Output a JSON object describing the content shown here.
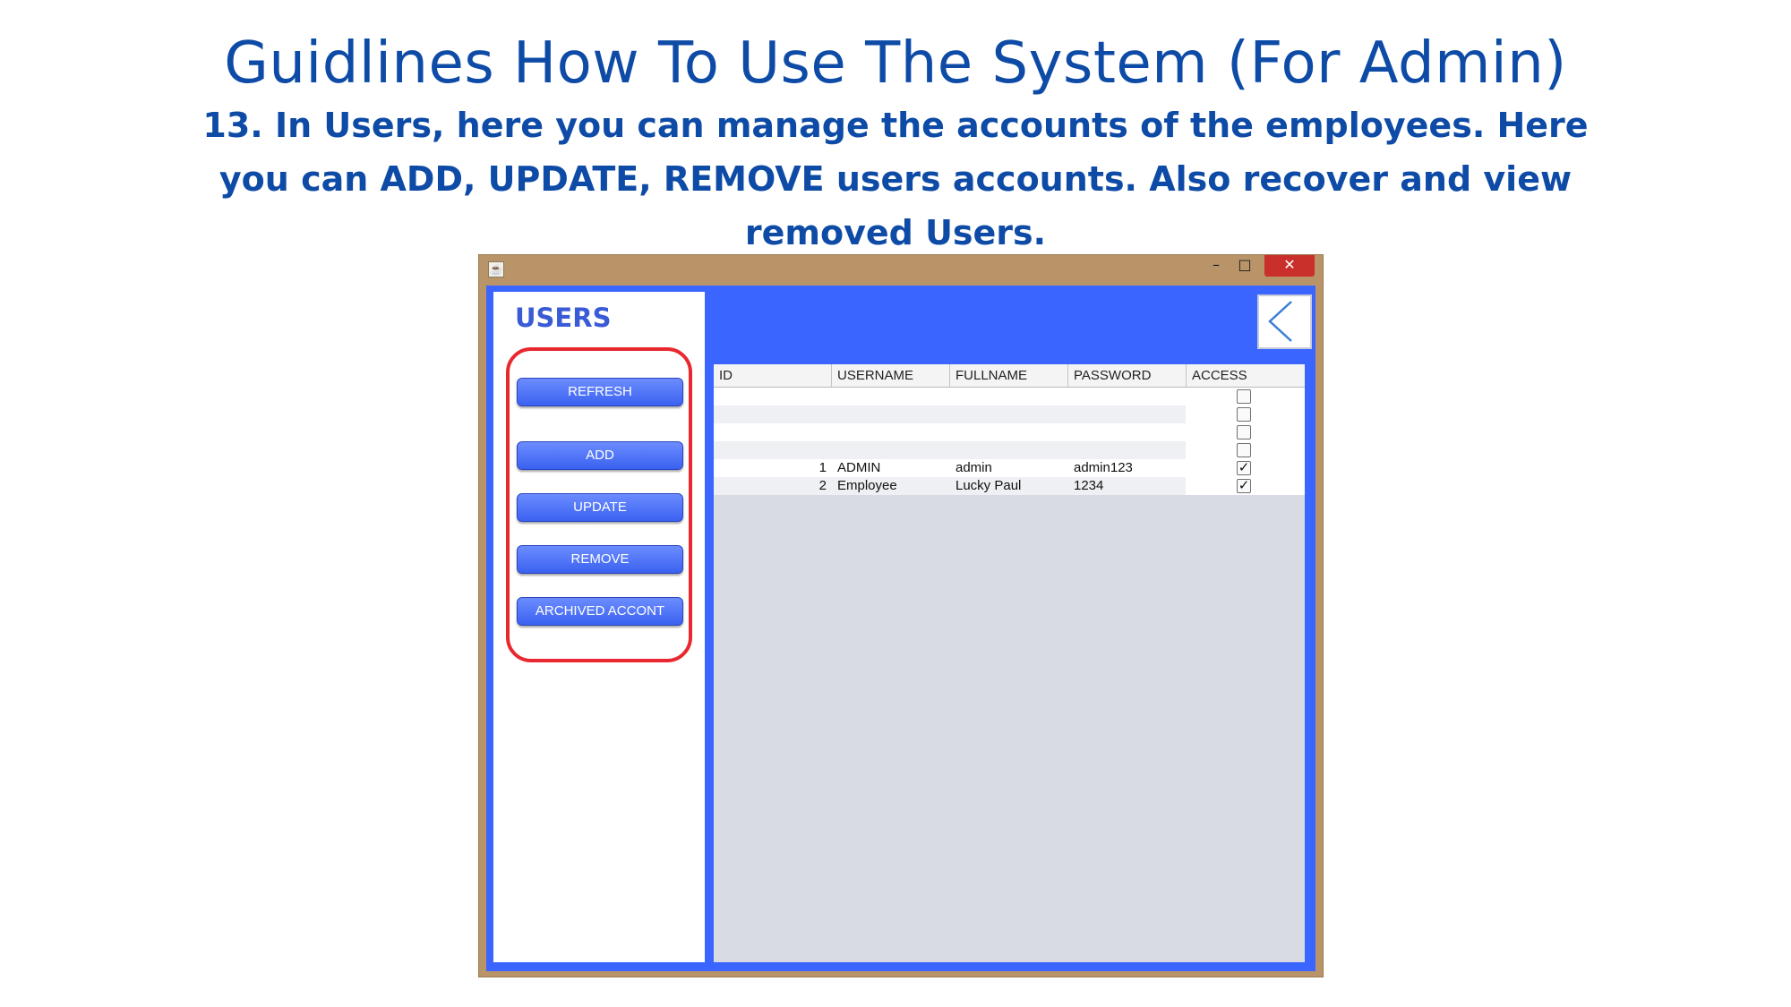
{
  "slide": {
    "title": "Guidlines  How To Use The System (For Admin)",
    "description": "13. In Users, here you can manage the accounts of the employees. Here you can ADD, UPDATE, REMOVE users accounts. Also recover and view removed Users."
  },
  "window": {
    "minimize_glyph": "–",
    "maximize_glyph": "□",
    "close_glyph": "✕"
  },
  "panel": {
    "title": "USERS",
    "buttons": {
      "refresh": "REFRESH",
      "add": "ADD",
      "update": "UPDATE",
      "remove": "REMOVE",
      "archived": "ARCHIVED ACCONT"
    }
  },
  "back_button": {
    "icon": "chevron-left-icon"
  },
  "table": {
    "columns": [
      "ID",
      "USERNAME",
      "FULLNAME",
      "PASSWORD",
      "ACCESS"
    ],
    "rows": [
      {
        "id": "",
        "username": "",
        "fullname": "",
        "password": "",
        "access": false
      },
      {
        "id": "",
        "username": "",
        "fullname": "",
        "password": "",
        "access": false
      },
      {
        "id": "",
        "username": "",
        "fullname": "",
        "password": "",
        "access": false
      },
      {
        "id": "",
        "username": "",
        "fullname": "",
        "password": "",
        "access": false
      },
      {
        "id": "1",
        "username": "ADMIN",
        "fullname": "admin",
        "password": "admin123",
        "access": true
      },
      {
        "id": "2",
        "username": "Employee",
        "fullname": "Lucky Paul",
        "password": "1234",
        "access": true
      }
    ]
  },
  "colors": {
    "title_blue": "#0e4ba6",
    "content_blue": "#3a66ff",
    "highlight_red": "#e8282e",
    "window_frame": "#b89468"
  }
}
